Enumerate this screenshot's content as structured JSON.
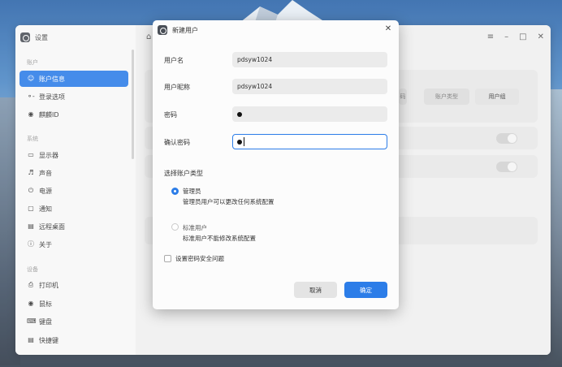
{
  "settings_window": {
    "app_title": "设置",
    "sidebar": {
      "sections": [
        {
          "label": "账户"
        },
        {
          "label": "系统"
        },
        {
          "label": "设备"
        }
      ],
      "items": [
        {
          "label": "账户信息",
          "icon": "user-icon",
          "active": true
        },
        {
          "label": "登录选项",
          "icon": "key-icon"
        },
        {
          "label": "麒麟ID",
          "icon": "kylin-id-icon"
        },
        {
          "label": "显示器",
          "icon": "monitor-icon"
        },
        {
          "label": "声音",
          "icon": "speaker-icon"
        },
        {
          "label": "电源",
          "icon": "power-icon"
        },
        {
          "label": "通知",
          "icon": "notification-icon"
        },
        {
          "label": "远程桌面",
          "icon": "remote-desktop-icon"
        },
        {
          "label": "关于",
          "icon": "info-icon"
        },
        {
          "label": "打印机",
          "icon": "printer-icon"
        },
        {
          "label": "鼠标",
          "icon": "mouse-icon"
        },
        {
          "label": "键盘",
          "icon": "keyboard-icon"
        },
        {
          "label": "快捷键",
          "icon": "shortcut-icon"
        }
      ]
    },
    "content": {
      "buttons": [
        "码",
        "账户类型",
        "用户组"
      ]
    }
  },
  "dialog": {
    "title": "新建用户",
    "fields": [
      {
        "label": "用户名",
        "value": "pdsyw1024"
      },
      {
        "label": "用户昵称",
        "value": "pdsyw1024"
      },
      {
        "label": "密码",
        "value": ""
      },
      {
        "label": "确认密码",
        "value": ""
      }
    ],
    "account_type_label": "选择账户类型",
    "options": [
      {
        "title": "管理员",
        "desc": "管理员用户可以更改任何系统配置",
        "checked": true
      },
      {
        "title": "标准用户",
        "desc": "标准用户不能修改系统配置",
        "checked": false
      }
    ],
    "security_question_label": "设置密码安全问题",
    "cancel_label": "取消",
    "ok_label": "确定"
  },
  "colors": {
    "accent": "#2c7de8",
    "dialog_bg": "#fcfcfc",
    "field_bg": "#ebebeb"
  }
}
